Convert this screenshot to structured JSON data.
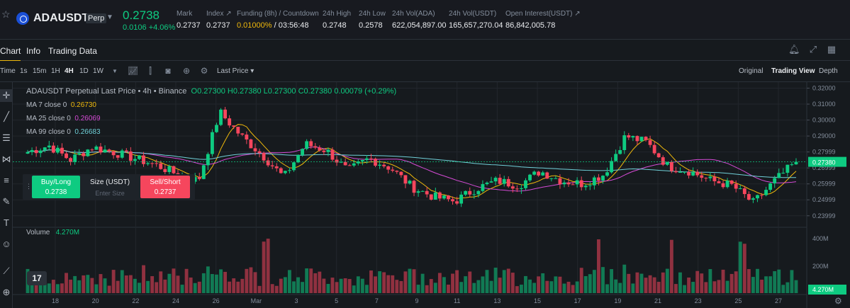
{
  "ticker": {
    "symbol": "ADAUSDT",
    "contract_type": "Perp",
    "last_price": "0.2738",
    "change": "0.0106 +4.06%",
    "stats": [
      {
        "label": "Mark",
        "value": "0.2737"
      },
      {
        "label": "Index ↗",
        "value": "0.2737"
      },
      {
        "label": "Funding (8h) / Countdown",
        "value_rate": "0.01000%",
        "value_countdown": " / 03:56:48"
      },
      {
        "label": "24h High",
        "value": "0.2748"
      },
      {
        "label": "24h Low",
        "value": "0.2578"
      },
      {
        "label": "24h Vol(ADA)",
        "value": "622,054,897.00"
      },
      {
        "label": "24h Vol(USDT)",
        "value": "165,657,270.04"
      },
      {
        "label": "Open Interest(USDT) ↗",
        "value": "86,842,005.78"
      }
    ]
  },
  "tabs": [
    "Chart",
    "Info",
    "Trading Data"
  ],
  "toolbar": {
    "time_label": "Time",
    "intervals": [
      "1s",
      "15m",
      "1H",
      "4H",
      "1D",
      "1W"
    ],
    "active_interval": "4H",
    "price_type": "Last Price",
    "views": [
      "Original",
      "Trading View",
      "Depth"
    ],
    "active_view": "Trading View"
  },
  "legend": {
    "title_prefix": "ADAUSDT Perpetual Last Price • 4h • Binance",
    "ohlc": "O0.27300 H0.27380 L0.27300 C0.27380 0.00079 (+0.29%)",
    "ma": [
      {
        "label": "MA 7 close 0",
        "value": "0.26730",
        "color": "#f0b90b"
      },
      {
        "label": "MA 25 close 0",
        "value": "0.26069",
        "color": "#d64bd6"
      },
      {
        "label": "MA 99 close 0",
        "value": "0.26683",
        "color": "#70d0d8"
      }
    ],
    "volume_label": "Volume",
    "volume_value": "4.270M"
  },
  "order_widget": {
    "buy_label": "Buy/Long",
    "buy_price": "0.2738",
    "size_label": "Size (USDT)",
    "size_placeholder": "Enter Size",
    "sell_label": "Sell/Short",
    "sell_price": "0.2737"
  },
  "tv_logo": "17",
  "colors": {
    "up": "#0ecb81",
    "down": "#f6465d",
    "accent": "#f0b90b",
    "ma7": "#f0b90b",
    "ma25": "#d64bd6",
    "ma99": "#70d0d8"
  },
  "chart_data": {
    "type": "candlestick",
    "price_axis_ticks": [
      "0.32000",
      "0.31000",
      "0.30000",
      "0.29000",
      "0.27999",
      "0.26999",
      "0.25999",
      "0.24999",
      "0.23999"
    ],
    "current_price_label": "0.27380",
    "hidden_tick_label": "0.26999",
    "volume_axis_ticks": [
      "400M",
      "200M"
    ],
    "current_volume_label": "4.270M",
    "x_tick_labels": [
      "18",
      "20",
      "22",
      "24",
      "26",
      "Mar",
      "3",
      "5",
      "7",
      "9",
      "11",
      "13",
      "15",
      "17",
      "19",
      "21",
      "23",
      "25",
      "27"
    ],
    "ylim": [
      0.235,
      0.322
    ],
    "price_path_approx": [
      {
        "x": "17",
        "y": 0.28
      },
      {
        "x": "18",
        "y": 0.284
      },
      {
        "x": "19",
        "y": 0.275
      },
      {
        "x": "20",
        "y": 0.283
      },
      {
        "x": "21",
        "y": 0.28
      },
      {
        "x": "22",
        "y": 0.276
      },
      {
        "x": "23",
        "y": 0.272
      },
      {
        "x": "24",
        "y": 0.266
      },
      {
        "x": "25",
        "y": 0.262
      },
      {
        "x": "26",
        "y": 0.305
      },
      {
        "x": "27",
        "y": 0.29
      },
      {
        "x": "28",
        "y": 0.278
      },
      {
        "x": "Mar",
        "y": 0.264
      },
      {
        "x": "2",
        "y": 0.285
      },
      {
        "x": "3",
        "y": 0.281
      },
      {
        "x": "4",
        "y": 0.268
      },
      {
        "x": "5",
        "y": 0.276
      },
      {
        "x": "6",
        "y": 0.27
      },
      {
        "x": "7",
        "y": 0.258
      },
      {
        "x": "8",
        "y": 0.252
      },
      {
        "x": "9",
        "y": 0.249
      },
      {
        "x": "10",
        "y": 0.257
      },
      {
        "x": "11",
        "y": 0.262
      },
      {
        "x": "12",
        "y": 0.259
      },
      {
        "x": "13",
        "y": 0.268
      },
      {
        "x": "14",
        "y": 0.262
      },
      {
        "x": "15",
        "y": 0.26
      },
      {
        "x": "16",
        "y": 0.266
      },
      {
        "x": "17",
        "y": 0.29
      },
      {
        "x": "18",
        "y": 0.286
      },
      {
        "x": "19",
        "y": 0.271
      },
      {
        "x": "20",
        "y": 0.268
      },
      {
        "x": "21",
        "y": 0.262
      },
      {
        "x": "22",
        "y": 0.259
      },
      {
        "x": "23",
        "y": 0.248
      },
      {
        "x": "24",
        "y": 0.262
      },
      {
        "x": "25",
        "y": 0.2738
      }
    ]
  }
}
